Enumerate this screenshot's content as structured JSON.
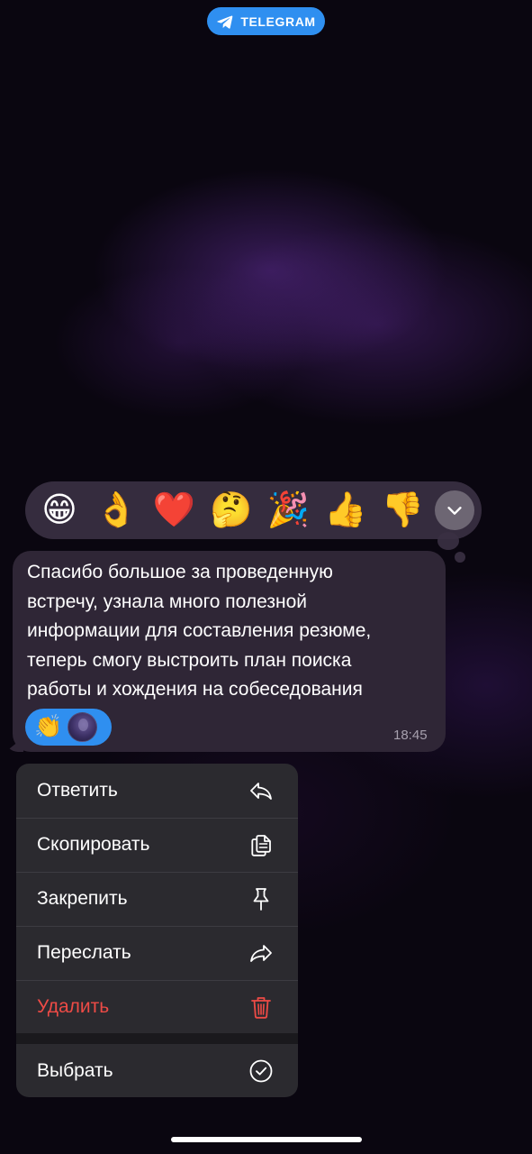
{
  "header": {
    "app_label": "TELEGRAM",
    "app_icon": "telegram-plane-icon",
    "pill_color": "#2f8ff0"
  },
  "reactions_bar": {
    "items": [
      {
        "emoji": "😁",
        "name": "grinning-face"
      },
      {
        "emoji": "👌",
        "name": "ok-hand"
      },
      {
        "emoji": "❤️",
        "name": "red-heart"
      },
      {
        "emoji": "🤔",
        "name": "thinking-face"
      },
      {
        "emoji": "🎉",
        "name": "party-popper"
      },
      {
        "emoji": "👍",
        "name": "thumbs-up"
      },
      {
        "emoji": "👎",
        "name": "thumbs-down"
      }
    ],
    "expand_icon": "chevron-down-icon"
  },
  "message": {
    "text": "Спасибо большое за проведенную\nвстречу, узнала много полезной\nинформации для составления резюме,\nтеперь смогу выстроить план поиска\nработы и хождения на собеседования",
    "time": "18:45",
    "reaction": {
      "emoji": "👏",
      "reactor_avatar": "avatar"
    }
  },
  "context_menu": {
    "items": [
      {
        "label": "Ответить",
        "icon": "reply-icon"
      },
      {
        "label": "Скопировать",
        "icon": "copy-icon"
      },
      {
        "label": "Закрепить",
        "icon": "pin-icon"
      },
      {
        "label": "Переслать",
        "icon": "forward-icon"
      },
      {
        "label": "Удалить",
        "icon": "trash-icon",
        "destructive": true,
        "color": "#ee4b46"
      },
      {
        "label": "Выбрать",
        "icon": "checkmark-circle-icon"
      }
    ]
  }
}
